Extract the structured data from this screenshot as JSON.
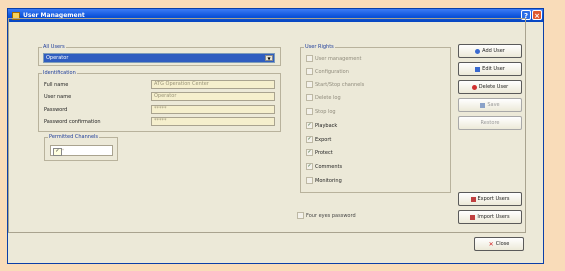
{
  "window": {
    "title": "User Management"
  },
  "users": {
    "group_label": "All Users",
    "selected": "Operator"
  },
  "identification": {
    "group_label": "Identification",
    "fields": [
      {
        "label": "Full name",
        "value": "ATG Operation Center"
      },
      {
        "label": "User name",
        "value": "Operator"
      },
      {
        "label": "Password",
        "value": "*****"
      },
      {
        "label": "Password confirmation",
        "value": "*****"
      }
    ]
  },
  "channels": {
    "group_label": "Permitted Channels",
    "value": "*"
  },
  "rights": {
    "group_label": "User Rights",
    "items": [
      {
        "label": "User management",
        "checked": false,
        "enabled": false
      },
      {
        "label": "Configuration",
        "checked": false,
        "enabled": false
      },
      {
        "label": "Start/Stop channels",
        "checked": false,
        "enabled": false
      },
      {
        "label": "Delete log",
        "checked": false,
        "enabled": false
      },
      {
        "label": "Stop log",
        "checked": false,
        "enabled": false
      },
      {
        "label": "Playback",
        "checked": true,
        "enabled": true
      },
      {
        "label": "Export",
        "checked": true,
        "enabled": true
      },
      {
        "label": "Protect",
        "checked": true,
        "enabled": true
      },
      {
        "label": "Comments",
        "checked": true,
        "enabled": true
      },
      {
        "label": "Monitoring",
        "checked": false,
        "enabled": true
      }
    ]
  },
  "four_eyes": {
    "label": "Four eyes password"
  },
  "buttons": {
    "add": "Add User",
    "edit": "Edit User",
    "delete": "Delete User",
    "save": "Save",
    "restore": "Restore",
    "export": "Export Users",
    "import": "Import Users",
    "close": "Close"
  }
}
